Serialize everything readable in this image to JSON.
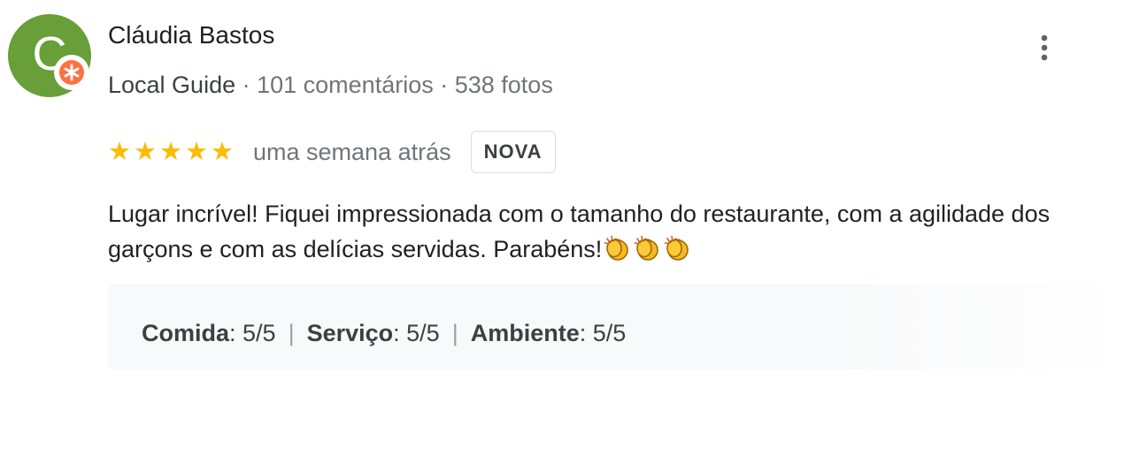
{
  "author": {
    "initial": "C",
    "name": "Cláudia Bastos",
    "guide_label": "Local Guide",
    "separator": " · ",
    "reviews_count": "101 comentários",
    "photos_count": "538 fotos"
  },
  "icons": {
    "avatar_color": "#689f38",
    "badge_color": "#ff7043",
    "star_color": "#fbbc04",
    "star_glyph": "★",
    "more": "more-vert-icon",
    "clap": "clapping-hands-emoji"
  },
  "review": {
    "rating": 5,
    "max_rating": 5,
    "time": "uma semana atrás",
    "new_badge": "NOVA",
    "text": "Lugar incrível! Fiquei impressionada com o tamanho do restaurante, com a agilidade dos garçons e com as delícias servidas. Parabéns!",
    "emoji_count": 3
  },
  "ratings": {
    "items": [
      {
        "label": "Comida",
        "value": ": 5/5"
      },
      {
        "label": "Serviço",
        "value": ": 5/5"
      },
      {
        "label": "Ambiente",
        "value": ": 5/5"
      }
    ],
    "separator": "|"
  }
}
